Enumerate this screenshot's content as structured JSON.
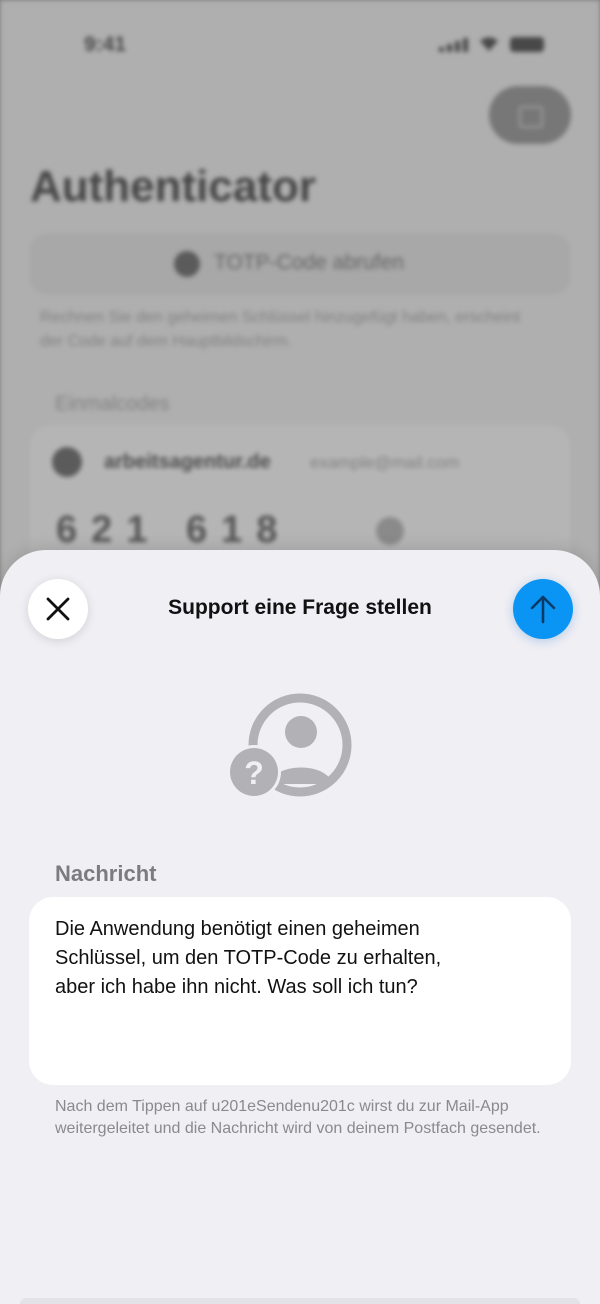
{
  "status_bar": {
    "time": "9:41"
  },
  "background": {
    "title": "Authenticator",
    "totp_button_label": "TOTP-Code abrufen",
    "hint": "Rechnen Sie den geheimen Schlüssel hinzugefügt haben, erscheint der Code auf dem Hauptbildschirm.",
    "section_label": "Einmalcodes",
    "account": {
      "domain": "arbeitsagentur.de",
      "email": "example@mail.com",
      "code": "621 618"
    }
  },
  "sheet": {
    "title": "Support eine Frage stellen",
    "close_icon": "close-icon",
    "send_icon": "arrow-up-icon",
    "accent_color": "#0a95f5",
    "field_label": "Nachricht",
    "message": "Die Anwendung benötigt einen geheimen\nSchlüssel, um den TOTP-Code zu erhalten,\naber ich habe ihn nicht. Was soll ich tun?",
    "footer_hint": "Nach dem Tippen auf u201eSendenu201c wirst du zur Mail-App weitergeleitet und die Nachricht wird von deinem Postfach gesendet."
  }
}
